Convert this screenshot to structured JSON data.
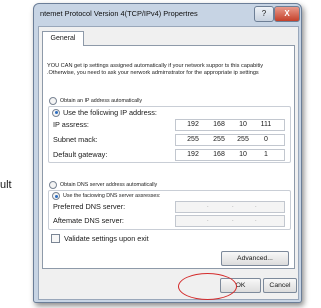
{
  "background": {
    "side_text": "ult"
  },
  "window": {
    "title": "ntemet Protocol Version 4(TCP/IPv4) Propertres",
    "help_label": "?",
    "close_label": "X"
  },
  "tabs": [
    {
      "label": "General"
    }
  ],
  "description": "YOU CAN get ip settings assigned automatically if your network suppor ts this capabitiy .Otherwise, you need to ask your nerwork admirnstrator for the appropriate ip settings",
  "ip_mode": {
    "auto_label": "Obtain an IP address automatically",
    "manual_label": "Use the folicwing IP address:",
    "selected": "manual"
  },
  "ip_fields": [
    {
      "label": "IP assress:",
      "octets": [
        "192",
        "168",
        "10",
        "111"
      ]
    },
    {
      "label": "Subnet mack:",
      "octets": [
        "255",
        "255",
        "255",
        "0"
      ]
    },
    {
      "label": "Default gateway:",
      "octets": [
        "192",
        "168",
        "10",
        "1"
      ]
    }
  ],
  "dns_mode": {
    "auto_label": "Obtain DNS server address automatically",
    "manual_label": "Use the faciowing DNS server assresses:",
    "selected": "manual"
  },
  "dns_fields": [
    {
      "label": "Preferred DNS server:",
      "octets": [
        "",
        "",
        "",
        ""
      ]
    },
    {
      "label": "Aftemate DNS server:",
      "octets": [
        "",
        "",
        "",
        ""
      ]
    }
  ],
  "validate": {
    "label": "Validate settings upon exit",
    "checked": false
  },
  "buttons": {
    "advanced": "Advanced...",
    "ok": "OK",
    "cancel": "Cancel"
  },
  "colors": {
    "highlight_ring": "#d42b2b",
    "radio_dot": "#2f6fc0"
  }
}
